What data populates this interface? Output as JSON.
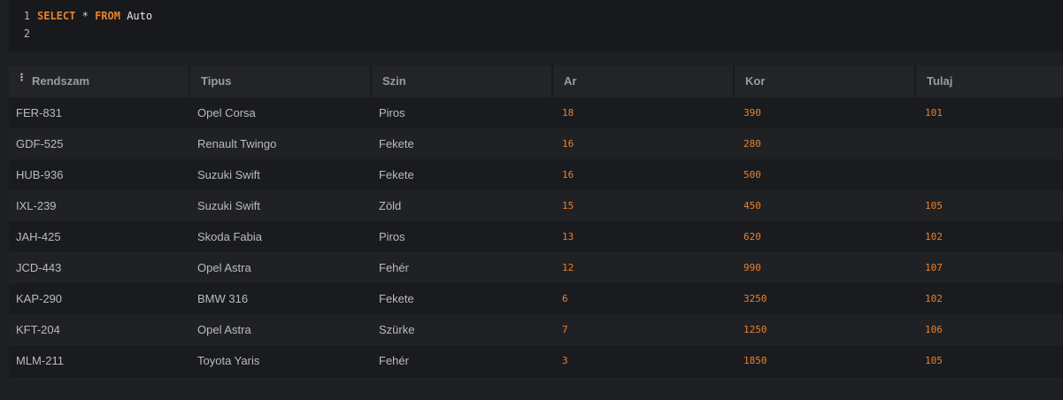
{
  "editor": {
    "lines": [
      {
        "number": "1",
        "keyword1": "SELECT",
        "op": "*",
        "keyword2": "FROM",
        "table": "Auto"
      },
      {
        "number": "2"
      }
    ]
  },
  "grid": {
    "columns": [
      "Rendszam",
      "Tipus",
      "Szin",
      "Ar",
      "Kor",
      "Tulaj"
    ],
    "rows": [
      [
        "FER-831",
        "Opel Corsa",
        "Piros",
        "18",
        "390",
        "101"
      ],
      [
        "GDF-525",
        "Renault Twingo",
        "Fekete",
        "16",
        "280",
        ""
      ],
      [
        "HUB-936",
        "Suzuki Swift",
        "Fekete",
        "16",
        "500",
        ""
      ],
      [
        "IXL-239",
        "Suzuki Swift",
        "Zöld",
        "15",
        "450",
        "105"
      ],
      [
        "JAH-425",
        "Skoda Fabia",
        "Piros",
        "13",
        "620",
        "102"
      ],
      [
        "JCD-443",
        "Opel Astra",
        "Fehér",
        "12",
        "990",
        "107"
      ],
      [
        "KAP-290",
        "BMW 316",
        "Fekete",
        "6",
        "3250",
        "102"
      ],
      [
        "KFT-204",
        "Opel Astra",
        "Szürke",
        "7",
        "1250",
        "106"
      ],
      [
        "MLM-211",
        "Toyota Yaris",
        "Fehér",
        "3",
        "1850",
        "105"
      ]
    ]
  },
  "colors": {
    "keyword": "#e8812f",
    "number": "#e8812f",
    "background": "#1e1f22"
  }
}
